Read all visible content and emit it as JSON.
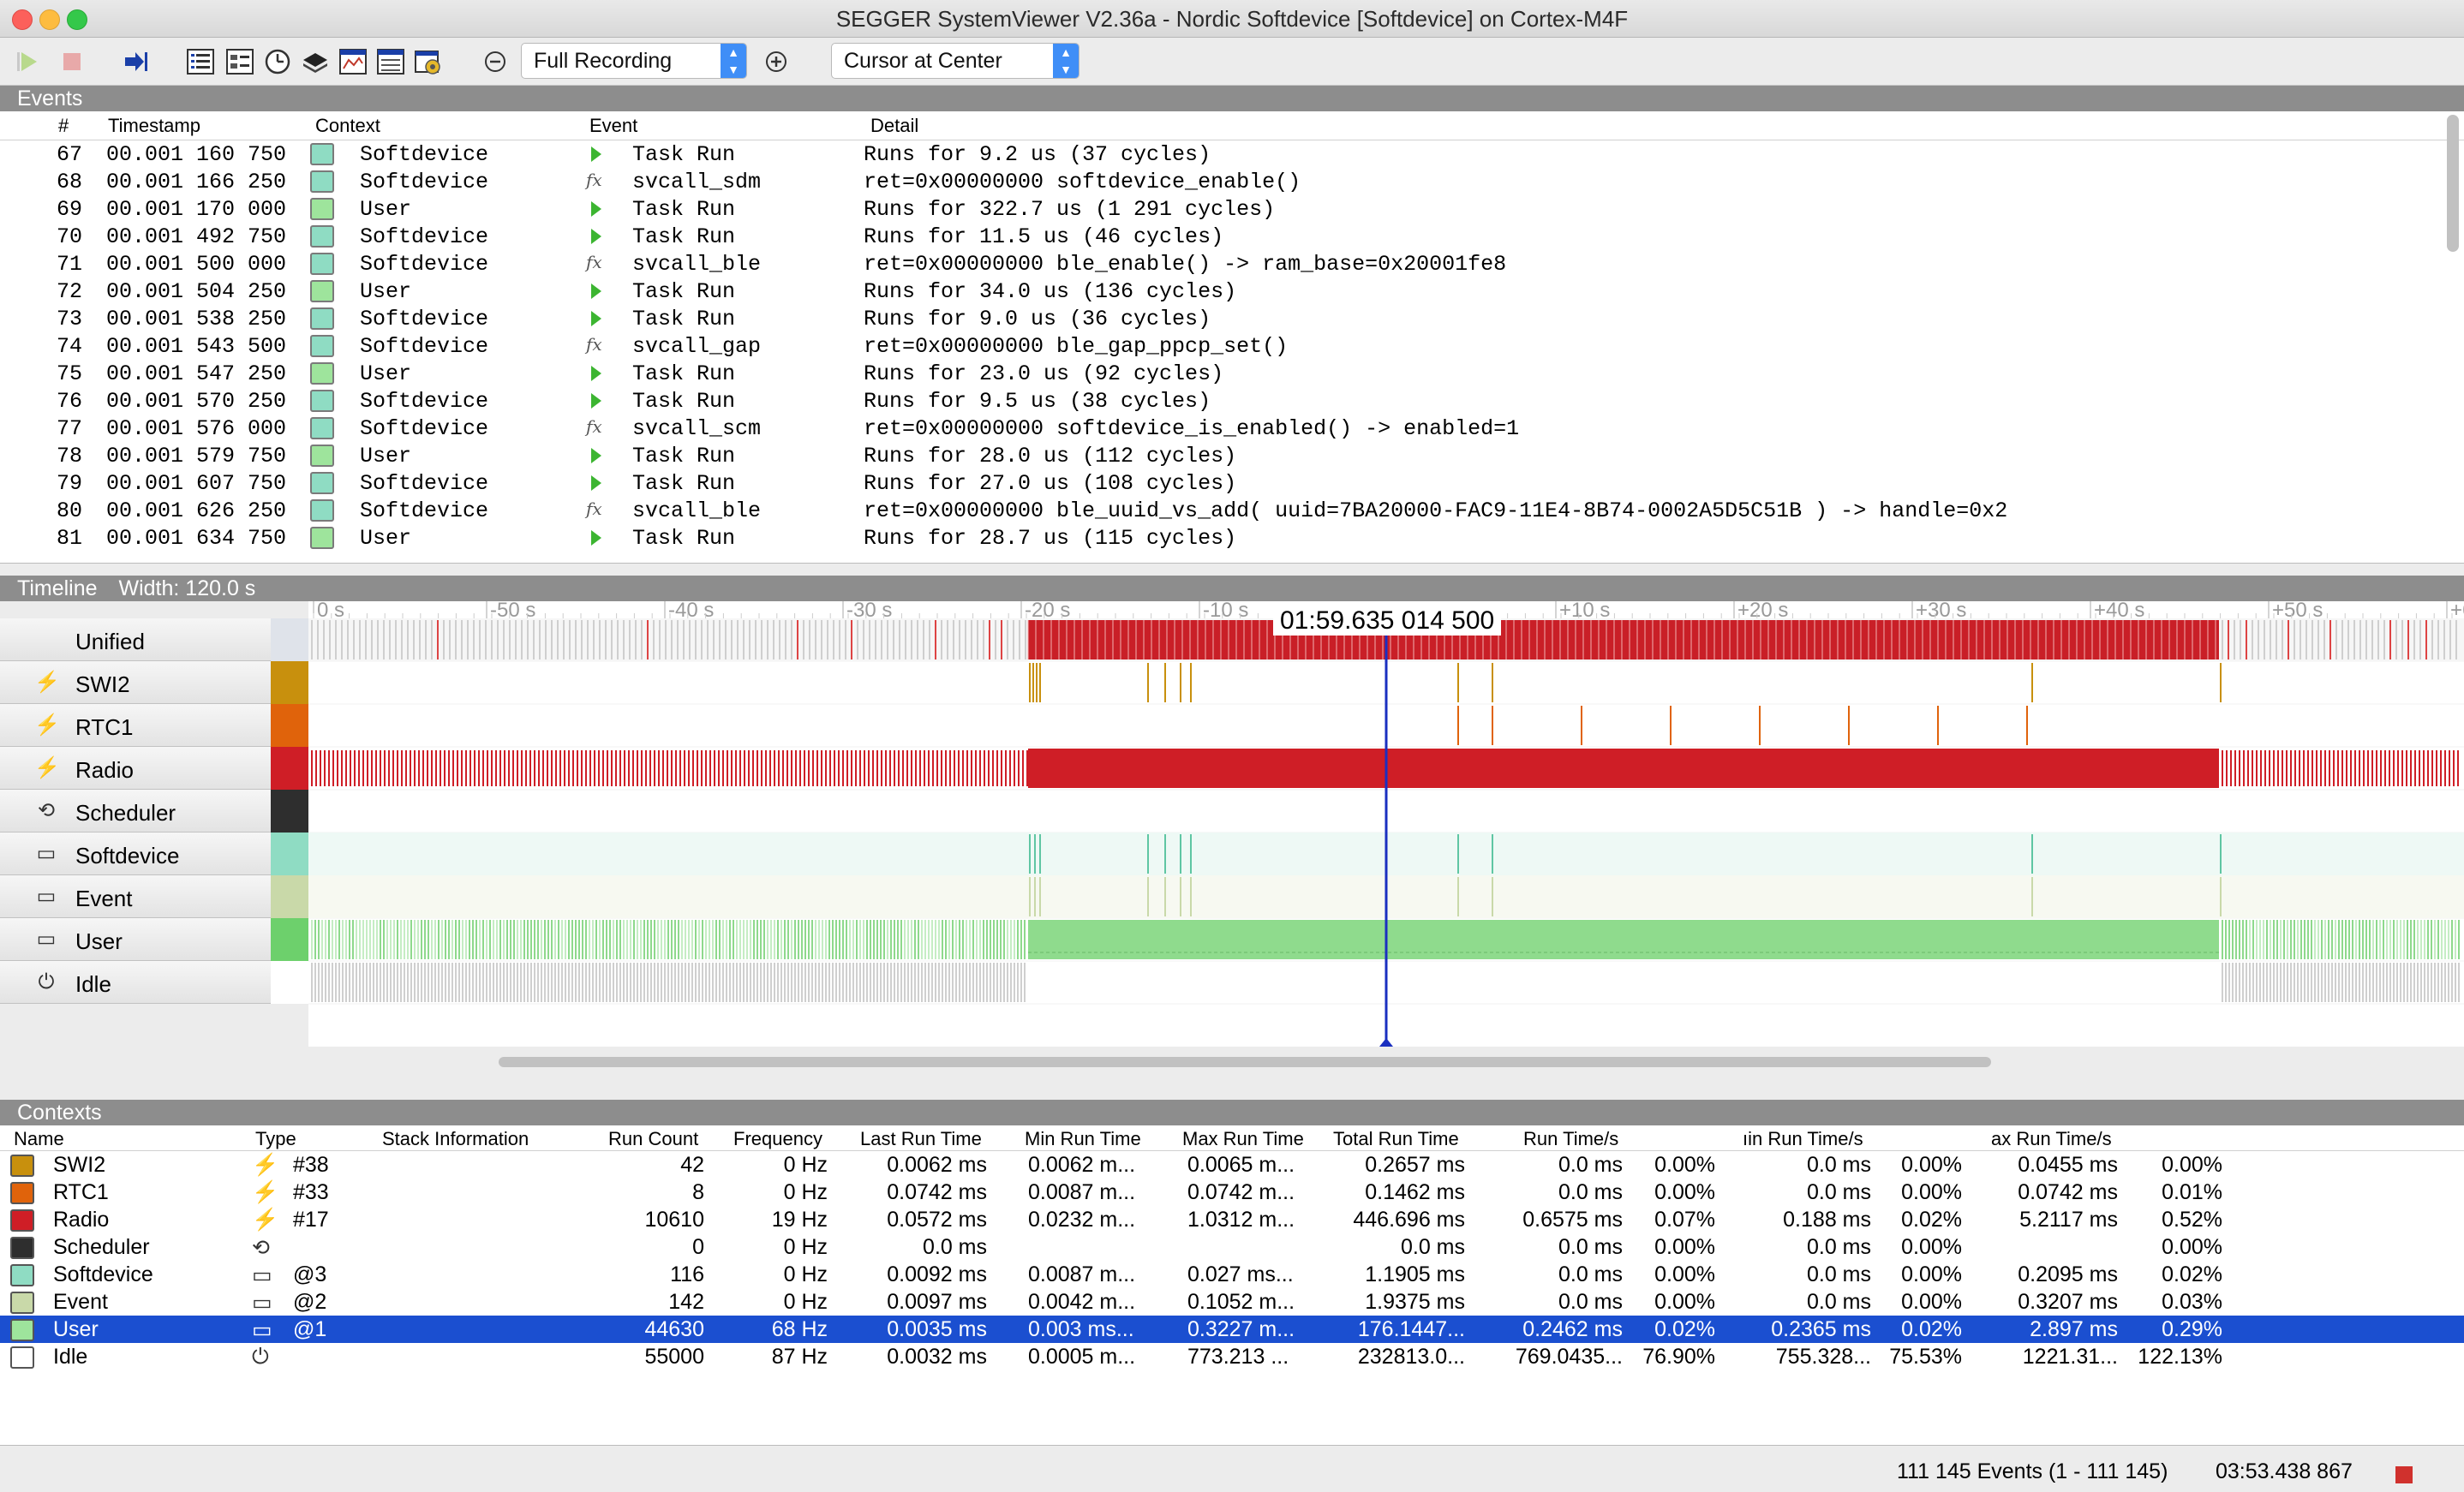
{
  "window": {
    "title": "SEGGER SystemViewer  V2.36a - Nordic Softdevice [Softdevice] on Cortex-M4F"
  },
  "toolbar": {
    "recording_mode": "Full Recording",
    "cursor_mode": "Cursor at Center"
  },
  "events": {
    "section_title": "Events",
    "columns": [
      "#",
      "Timestamp",
      "Context",
      "Event",
      "Detail"
    ],
    "rows": [
      {
        "num": "67",
        "ts": "00.001 160 750",
        "ctx": "Softdevice",
        "kind": "run",
        "event": "Task Run",
        "detail": "Runs for 9.2 us (37 cycles)"
      },
      {
        "num": "68",
        "ts": "00.001 166 250",
        "ctx": "Softdevice",
        "kind": "fx",
        "event": "svcall_sdm",
        "detail": "ret=0x00000000 softdevice_enable()"
      },
      {
        "num": "69",
        "ts": "00.001 170 000",
        "ctx": "User",
        "kind": "run",
        "event": "Task Run",
        "detail": "Runs for 322.7 us (1 291 cycles)"
      },
      {
        "num": "70",
        "ts": "00.001 492 750",
        "ctx": "Softdevice",
        "kind": "run",
        "event": "Task Run",
        "detail": "Runs for 11.5 us (46 cycles)"
      },
      {
        "num": "71",
        "ts": "00.001 500 000",
        "ctx": "Softdevice",
        "kind": "fx",
        "event": "svcall_ble",
        "detail": "ret=0x00000000 ble_enable() -> ram_base=0x20001fe8"
      },
      {
        "num": "72",
        "ts": "00.001 504 250",
        "ctx": "User",
        "kind": "run",
        "event": "Task Run",
        "detail": "Runs for 34.0 us (136 cycles)"
      },
      {
        "num": "73",
        "ts": "00.001 538 250",
        "ctx": "Softdevice",
        "kind": "run",
        "event": "Task Run",
        "detail": "Runs for 9.0 us (36 cycles)"
      },
      {
        "num": "74",
        "ts": "00.001 543 500",
        "ctx": "Softdevice",
        "kind": "fx",
        "event": "svcall_gap",
        "detail": "ret=0x00000000 ble_gap_ppcp_set()"
      },
      {
        "num": "75",
        "ts": "00.001 547 250",
        "ctx": "User",
        "kind": "run",
        "event": "Task Run",
        "detail": "Runs for 23.0 us (92 cycles)"
      },
      {
        "num": "76",
        "ts": "00.001 570 250",
        "ctx": "Softdevice",
        "kind": "run",
        "event": "Task Run",
        "detail": "Runs for 9.5 us (38 cycles)"
      },
      {
        "num": "77",
        "ts": "00.001 576 000",
        "ctx": "Softdevice",
        "kind": "fx",
        "event": "svcall_scm",
        "detail": "ret=0x00000000 softdevice_is_enabled() -> enabled=1"
      },
      {
        "num": "78",
        "ts": "00.001 579 750",
        "ctx": "User",
        "kind": "run",
        "event": "Task Run",
        "detail": "Runs for 28.0 us (112 cycles)"
      },
      {
        "num": "79",
        "ts": "00.001 607 750",
        "ctx": "Softdevice",
        "kind": "run",
        "event": "Task Run",
        "detail": "Runs for 27.0 us (108 cycles)"
      },
      {
        "num": "80",
        "ts": "00.001 626 250",
        "ctx": "Softdevice",
        "kind": "fx",
        "event": "svcall_ble",
        "detail": "ret=0x00000000 ble_uuid_vs_add( uuid=7BA20000-FAC9-11E4-8B74-0002A5D5C51B ) -> handle=0x2"
      },
      {
        "num": "81",
        "ts": "00.001 634 750",
        "ctx": "User",
        "kind": "run",
        "event": "Task Run",
        "detail": "Runs for 28.7 us (115 cycles)"
      }
    ]
  },
  "timeline": {
    "section_title": "Timeline",
    "width_label": "Width: 120.0 s",
    "cursor_time": "01:59.635 014 500",
    "ticks": [
      "0 s",
      "-50 s",
      "-40 s",
      "-30 s",
      "-20 s",
      "-10 s",
      "+10 s",
      "+20 s",
      "+30 s",
      "+40 s",
      "+50 s",
      "+60"
    ],
    "tracks": [
      {
        "name": "Unified",
        "icon": "none",
        "color": "#dfe3ea"
      },
      {
        "name": "SWI2",
        "icon": "lightning-icon",
        "color": "#c8900d"
      },
      {
        "name": "RTC1",
        "icon": "lightning-icon",
        "color": "#e0630b"
      },
      {
        "name": "Radio",
        "icon": "lightning-icon",
        "color": "#cf1e26"
      },
      {
        "name": "Scheduler",
        "icon": "refresh-icon",
        "color": "#2e2e2e"
      },
      {
        "name": "Softdevice",
        "icon": "task-icon",
        "color": "#8fdcc3"
      },
      {
        "name": "Event",
        "icon": "task-icon",
        "color": "#c9d9a9"
      },
      {
        "name": "User",
        "icon": "task-icon",
        "color": "#6dd06c"
      },
      {
        "name": "Idle",
        "icon": "power-icon",
        "color": "#ffffff"
      }
    ]
  },
  "contexts": {
    "section_title": "Contexts",
    "columns": [
      "Name",
      "Type",
      "Stack Information",
      "Run Count",
      "Frequency",
      "Last Run Time",
      "Min Run Time",
      "Max Run Time",
      "Total Run Time",
      "Run Time/s",
      "",
      "ıin Run Time/s",
      "",
      "ax Run Time/s",
      ""
    ],
    "rows": [
      {
        "name": "SWI2",
        "color": "#c8900d",
        "icon": "lightning-icon",
        "type": "#38",
        "count": "42",
        "freq": "0 Hz",
        "last": "0.0062 ms",
        "min": "0.0062 m...",
        "max": "0.0065 m...",
        "total": "0.2657 ms",
        "rts": "0.0 ms",
        "rtsp": "0.00%",
        "mrts": "0.0 ms",
        "mrtsp": "0.00%",
        "xrts": "0.0455 ms",
        "xrtsp": "0.00%"
      },
      {
        "name": "RTC1",
        "color": "#e0630b",
        "icon": "lightning-icon",
        "type": "#33",
        "count": "8",
        "freq": "0 Hz",
        "last": "0.0742 ms",
        "min": "0.0087 m...",
        "max": "0.0742 m...",
        "total": "0.1462 ms",
        "rts": "0.0 ms",
        "rtsp": "0.00%",
        "mrts": "0.0 ms",
        "mrtsp": "0.00%",
        "xrts": "0.0742 ms",
        "xrtsp": "0.01%"
      },
      {
        "name": "Radio",
        "color": "#cf1e26",
        "icon": "lightning-icon",
        "type": "#17",
        "count": "10610",
        "freq": "19 Hz",
        "last": "0.0572 ms",
        "min": "0.0232 m...",
        "max": "1.0312 m...",
        "total": "446.696 ms",
        "rts": "0.6575 ms",
        "rtsp": "0.07%",
        "mrts": "0.188 ms",
        "mrtsp": "0.02%",
        "xrts": "5.2117 ms",
        "xrtsp": "0.52%"
      },
      {
        "name": "Scheduler",
        "color": "#2e2e2e",
        "icon": "refresh-icon",
        "type": "",
        "count": "0",
        "freq": "0 Hz",
        "last": "0.0 ms",
        "min": "",
        "max": "",
        "total": "0.0 ms",
        "rts": "0.0 ms",
        "rtsp": "0.00%",
        "mrts": "0.0 ms",
        "mrtsp": "0.00%",
        "xrts": "",
        "xrtsp": "0.00%"
      },
      {
        "name": "Softdevice",
        "color": "#8fdcc3",
        "icon": "task-icon",
        "type": "@3",
        "count": "116",
        "freq": "0 Hz",
        "last": "0.0092 ms",
        "min": "0.0087 m...",
        "max": "0.027 ms...",
        "total": "1.1905 ms",
        "rts": "0.0 ms",
        "rtsp": "0.00%",
        "mrts": "0.0 ms",
        "mrtsp": "0.00%",
        "xrts": "0.2095 ms",
        "xrtsp": "0.02%"
      },
      {
        "name": "Event",
        "color": "#c9d9a9",
        "icon": "task-icon",
        "type": "@2",
        "count": "142",
        "freq": "0 Hz",
        "last": "0.0097 ms",
        "min": "0.0042 m...",
        "max": "0.1052 m...",
        "total": "1.9375 ms",
        "rts": "0.0 ms",
        "rtsp": "0.00%",
        "mrts": "0.0 ms",
        "mrtsp": "0.00%",
        "xrts": "0.3207 ms",
        "xrtsp": "0.03%"
      },
      {
        "name": "User",
        "color": "#9ee49c",
        "icon": "task-icon",
        "type": "@1",
        "count": "44630",
        "freq": "68 Hz",
        "last": "0.0035 ms",
        "min": "0.003 ms...",
        "max": "0.3227 m...",
        "total": "176.1447...",
        "rts": "0.2462 ms",
        "rtsp": "0.02%",
        "mrts": "0.2365 ms",
        "mrtsp": "0.02%",
        "xrts": "2.897 ms",
        "xrtsp": "0.29%",
        "selected": true
      },
      {
        "name": "Idle",
        "color": "#ffffff",
        "icon": "power-icon",
        "type": "",
        "count": "55000",
        "freq": "87 Hz",
        "last": "0.0032 ms",
        "min": "0.0005 m...",
        "max": "773.213 ...",
        "total": "232813.0...",
        "rts": "769.0435...",
        "rtsp": "76.90%",
        "mrts": "755.328...",
        "mrtsp": "75.53%",
        "xrts": "1221.31...",
        "xrtsp": "122.13%"
      }
    ]
  },
  "status": {
    "events": "111 145 Events (1 - 111 145)",
    "time": "03:53.438 867"
  }
}
